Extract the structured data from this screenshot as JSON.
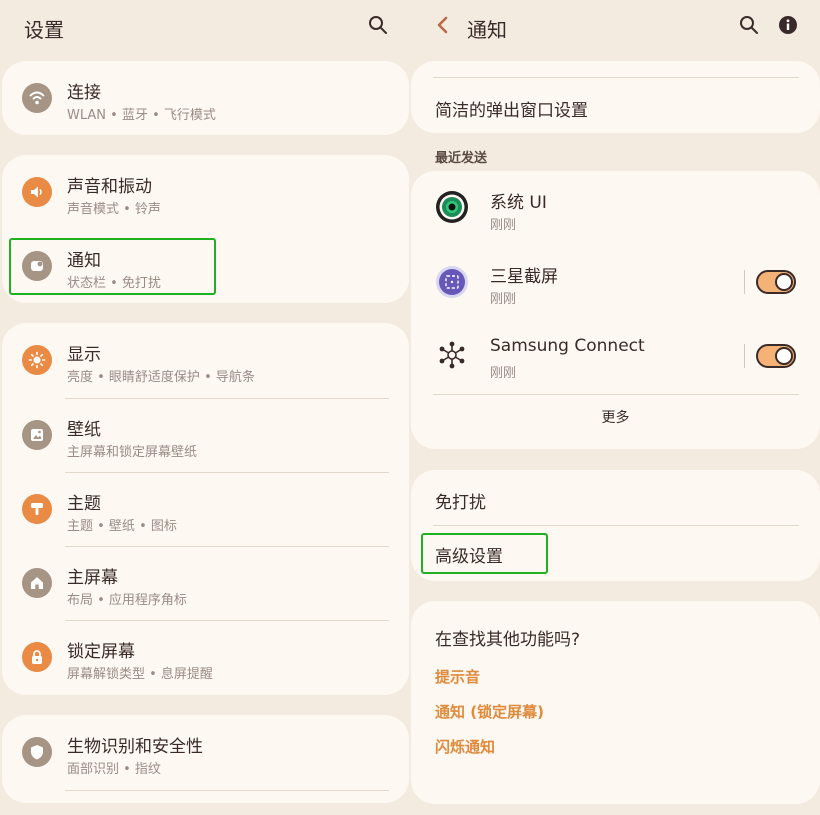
{
  "left": {
    "header": {
      "title": "设置",
      "search_icon": "search-icon"
    },
    "groups": [
      {
        "items": [
          {
            "icon": "wifi-icon",
            "title": "连接",
            "subtitle": "WLAN • 蓝牙 • 飞行模式"
          }
        ]
      },
      {
        "items": [
          {
            "icon": "volume-icon",
            "title": "声音和振动",
            "subtitle": "声音模式 • 铃声"
          },
          {
            "icon": "notification-icon",
            "title": "通知",
            "subtitle": "状态栏 • 免打扰"
          }
        ]
      },
      {
        "items": [
          {
            "icon": "brightness-icon",
            "title": "显示",
            "subtitle": "亮度 • 眼睛舒适度保护 • 导航条"
          },
          {
            "icon": "wallpaper-icon",
            "title": "壁纸",
            "subtitle": "主屏幕和锁定屏幕壁纸"
          },
          {
            "icon": "theme-icon",
            "title": "主题",
            "subtitle": "主题 • 壁纸 • 图标"
          },
          {
            "icon": "home-icon",
            "title": "主屏幕",
            "subtitle": "布局 • 应用程序角标"
          },
          {
            "icon": "lock-icon",
            "title": "锁定屏幕",
            "subtitle": "屏幕解锁类型 • 息屏提醒"
          }
        ]
      },
      {
        "items": [
          {
            "icon": "shield-icon",
            "title": "生物识别和安全性",
            "subtitle": "面部识别 • 指纹"
          }
        ]
      }
    ]
  },
  "right": {
    "header": {
      "back_icon": "back-chevron-icon",
      "title": "通知",
      "search_icon": "search-icon",
      "info_icon": "info-icon"
    },
    "popup_style": "简洁的弹出窗口设置",
    "recent_label": "最近发送",
    "recent": [
      {
        "icon": "system-ui-icon",
        "title": "系统 UI",
        "subtitle": "刚刚",
        "toggle": false
      },
      {
        "icon": "screenshot-icon",
        "title": "三星截屏",
        "subtitle": "刚刚",
        "toggle": true,
        "toggle_on": true
      },
      {
        "icon": "samsung-connect-icon",
        "title": "Samsung Connect",
        "subtitle": "刚刚",
        "toggle": true,
        "toggle_on": true
      }
    ],
    "more": "更多",
    "dnd": "免打扰",
    "advanced": "高级设置",
    "looking_for": "在查找其他功能吗?",
    "links": [
      "提示音",
      "通知 (锁定屏幕)",
      "闪烁通知"
    ]
  },
  "colors": {
    "accent": "#e08a3c",
    "highlight": "#20b020",
    "card": "#fdf8f2",
    "bg": "#f3ebe0"
  }
}
